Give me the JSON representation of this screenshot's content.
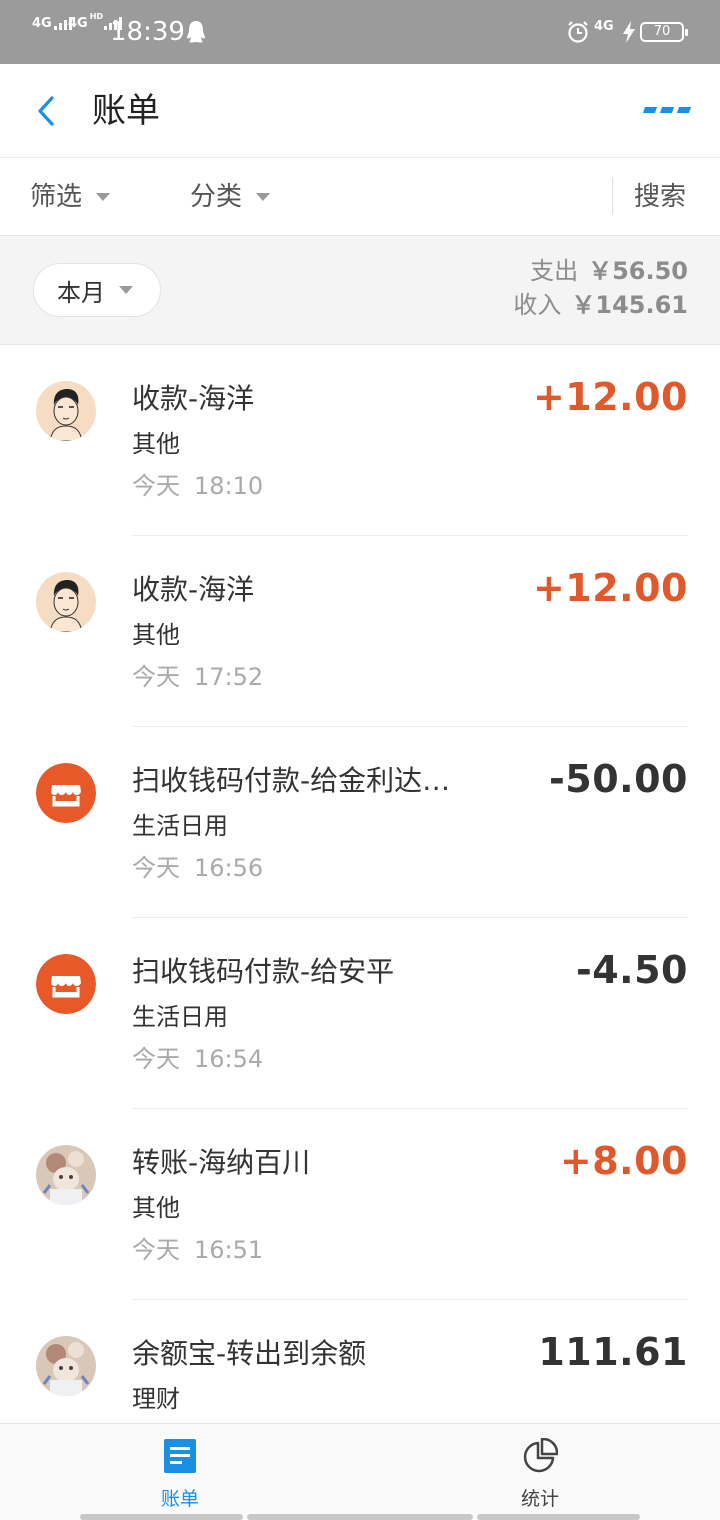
{
  "status_bar": {
    "sim1": "4G",
    "sim2": "4G",
    "hd_label": "HD",
    "time": "18:39",
    "network": "4G",
    "battery": "70"
  },
  "header": {
    "title": "账单",
    "back_icon": "chevron-left-icon",
    "more_icon": "more-dots-icon"
  },
  "filters": {
    "filter_label": "筛选",
    "category_label": "分类",
    "search_label": "搜索"
  },
  "month_bar": {
    "month_label": "本月",
    "expense_label": "支出",
    "expense_amount": "￥56.50",
    "income_label": "收入",
    "income_amount": "￥145.61"
  },
  "transactions": [
    {
      "title": "收款-海洋",
      "category": "其他",
      "day": "今天",
      "time": "18:10",
      "amount": "+12.00",
      "direction": "in",
      "avatar": "person-portrait"
    },
    {
      "title": "收款-海洋",
      "category": "其他",
      "day": "今天",
      "time": "17:52",
      "amount": "+12.00",
      "direction": "in",
      "avatar": "person-portrait"
    },
    {
      "title": "扫收钱码付款-给金利达…",
      "category": "生活日用",
      "day": "今天",
      "time": "16:56",
      "amount": "-50.00",
      "direction": "out",
      "avatar": "shop-icon"
    },
    {
      "title": "扫收钱码付款-给安平",
      "category": "生活日用",
      "day": "今天",
      "time": "16:54",
      "amount": "-4.50",
      "direction": "out",
      "avatar": "shop-icon"
    },
    {
      "title": "转账-海纳百川",
      "category": "其他",
      "day": "今天",
      "time": "16:51",
      "amount": "+8.00",
      "direction": "in",
      "avatar": "user-photo"
    },
    {
      "title": "余额宝-转出到余额",
      "category": "理财",
      "day": "",
      "time": "",
      "amount": "111.61",
      "direction": "neutral",
      "avatar": "user-photo"
    }
  ],
  "tabs": [
    {
      "label": "账单",
      "icon": "bill-list-icon",
      "active": true
    },
    {
      "label": "统计",
      "icon": "pie-chart-icon",
      "active": false
    }
  ],
  "colors": {
    "accent": "#1a8fe3",
    "income": "#e0592b",
    "shop": "#e8592a",
    "status_bar": "#9b9b9b"
  }
}
